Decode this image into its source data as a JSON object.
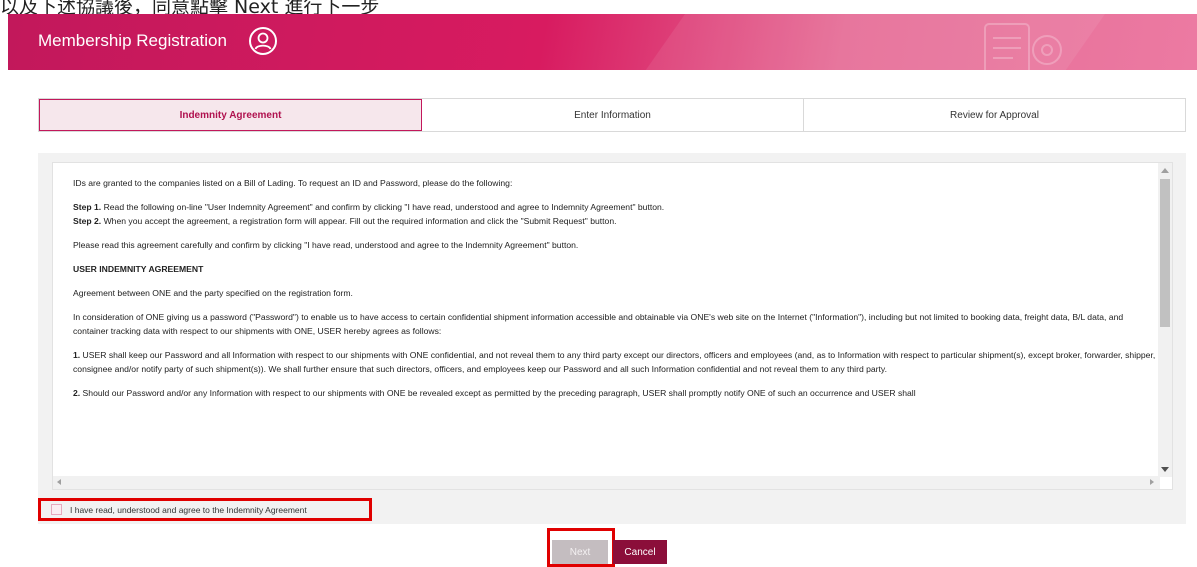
{
  "top_caption": "以及下述協議後，同意點擊 Next 進行下一步",
  "header": {
    "title": "Membership Registration"
  },
  "steps": [
    {
      "label": "Indemnity Agreement",
      "active": true
    },
    {
      "label": "Enter Information",
      "active": false
    },
    {
      "label": "Review for Approval",
      "active": false
    }
  ],
  "agreement": {
    "intro": "IDs are granted to the companies listed on a Bill of Lading. To request an ID and Password, please do the following:",
    "step1_label": "Step 1.",
    "step1_text": " Read the following on-line \"User Indemnity Agreement\" and confirm by clicking \"I have read, understood and agree to Indemnity Agreement\" button.",
    "step2_label": "Step 2.",
    "step2_text": " When you accept the agreement, a registration form will appear. Fill out the required information and click the \"Submit Request\" button.",
    "please_read": "Please read this agreement carefully and confirm by clicking \"I have read, understood and agree to the Indemnity Agreement\" button.",
    "heading": "USER INDEMNITY AGREEMENT",
    "between": "Agreement between ONE and the party specified on the registration form.",
    "consideration": " In consideration of ONE giving us a password (\"Password\") to enable us to have access to certain confidential shipment information accessible and obtainable via ONE's web site on the Internet (\"Information\"), including but not limited to booking data, freight data, B/L data, and container tracking data with respect to our shipments with ONE, USER hereby agrees as follows:",
    "clause1_num": "1.",
    "clause1_text": " USER shall keep our Password and all Information with respect to our shipments with ONE confidential, and not reveal them to any third party except our directors, officers and employees (and, as to Information with respect to particular shipment(s), except broker, forwarder, shipper, consignee and/or notify party of such shipment(s)). We shall further ensure that such directors, officers, and employees keep our Password and all such Information confidential and not reveal them to any third party.",
    "clause2_num": "2.",
    "clause2_text": " Should our Password and/or any Information with respect to our shipments with ONE be revealed except as permitted by the preceding paragraph, USER shall promptly notify ONE of such an occurrence and USER shall"
  },
  "agree_checkbox": {
    "label": "I have read, understood and agree to the Indemnity Agreement",
    "checked": false
  },
  "buttons": {
    "next": "Next",
    "cancel": "Cancel"
  },
  "colors": {
    "brand": "#c2185b",
    "cancel_bg": "#8b0e3a",
    "next_disabled_bg": "#c4bdc0",
    "highlight": "#e00000"
  }
}
